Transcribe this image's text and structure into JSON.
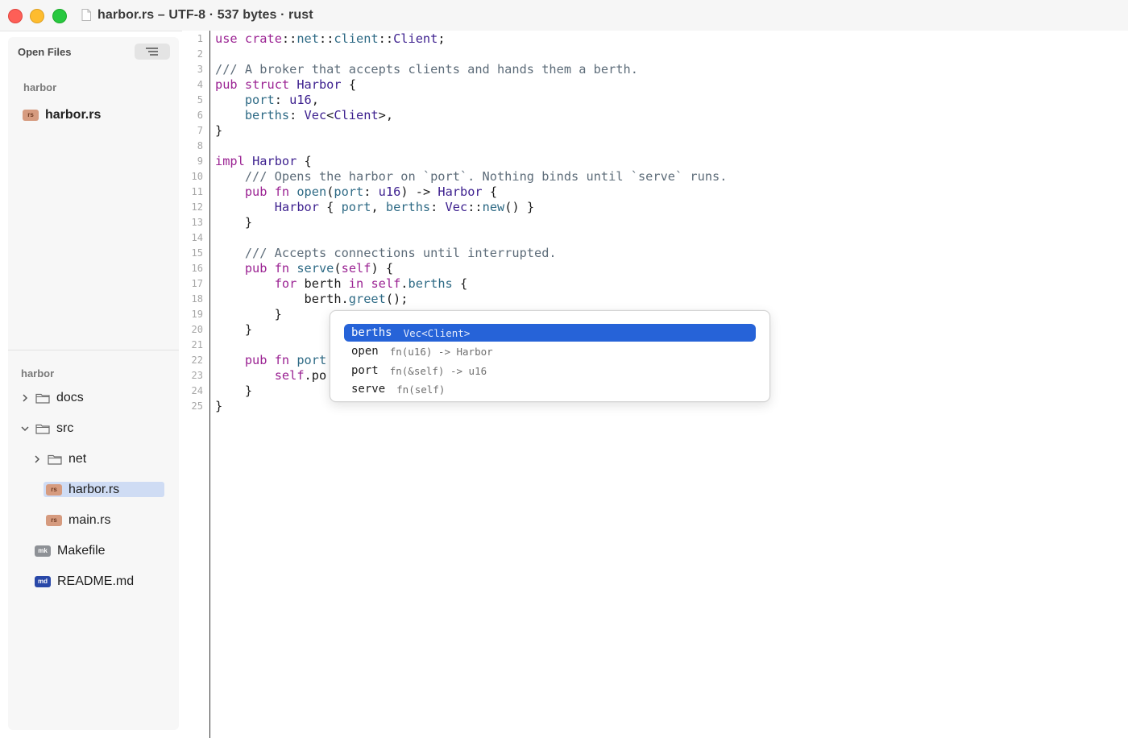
{
  "window": {
    "title": "harbor.rs – UTF-8 · 537 bytes · rust"
  },
  "sidebar": {
    "open_files_label": "Open Files",
    "open_group_label": "harbor",
    "open_files": [
      {
        "badge": "rs",
        "name": "harbor.rs"
      }
    ],
    "project_label": "harbor",
    "tree": [
      {
        "type": "folder",
        "name": "docs",
        "expanded": false
      },
      {
        "type": "folder",
        "name": "src",
        "expanded": true
      },
      {
        "type": "folder",
        "name": "net",
        "expanded": false
      },
      {
        "type": "file",
        "badge": "rs",
        "name": "harbor.rs",
        "selected": true
      },
      {
        "type": "file",
        "badge": "rs",
        "name": "main.rs"
      },
      {
        "type": "file",
        "badge": "mk",
        "name": "Makefile"
      },
      {
        "type": "file",
        "badge": "md",
        "name": "README.md"
      }
    ]
  },
  "editor": {
    "line_numbers": [
      "1",
      "2",
      "3",
      "4",
      "5",
      "6",
      "7",
      "8",
      "9",
      "10",
      "11",
      "12",
      "13",
      "14",
      "15",
      "16",
      "17",
      "18",
      "19",
      "20",
      "21",
      "22",
      "23",
      "24",
      "25"
    ],
    "lines": [
      "use crate::net::client::Client;",
      "",
      "/// A broker that accepts clients and hands them a berth.",
      "pub struct Harbor {",
      "    port: u16,",
      "    berths: Vec<Client>,",
      "}",
      "",
      "impl Harbor {",
      "    /// Opens the harbor on `port`. Nothing binds until `serve` runs.",
      "    pub fn open(port: u16) -> Harbor {",
      "        Harbor { port, berths: Vec::new() }",
      "    }",
      "",
      "    /// Accepts connections until interrupted.",
      "    pub fn serve(self) {",
      "        for berth in self.berths {",
      "            berth.greet();",
      "        }",
      "    }",
      "",
      "    pub fn port",
      "        self.po",
      "    }",
      "}"
    ]
  },
  "autocomplete": {
    "items": [
      {
        "name": "berths",
        "signature": "Vec<Client>",
        "active": true
      },
      {
        "name": "open",
        "signature": "fn(u16) -> Harbor"
      },
      {
        "name": "port",
        "signature": "fn(&self) -> u16"
      },
      {
        "name": "serve",
        "signature": "fn(self)"
      }
    ]
  },
  "colors": {
    "keyword": "#9b2393",
    "type": "#3c1f8e",
    "field": "#2e6a85",
    "comment": "#5d6c79",
    "selection": "#2663d8"
  },
  "icons": [
    "document-icon",
    "list-toggle-icon",
    "chevron-right-icon",
    "chevron-down-icon",
    "folder-icon"
  ]
}
